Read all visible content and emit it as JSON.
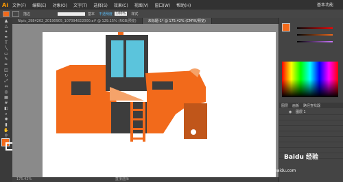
{
  "menu": {
    "logo": "Ai",
    "items": [
      "文件(F)",
      "编辑(E)",
      "对象(O)",
      "文字(T)",
      "选择(S)",
      "效果(C)",
      "视图(V)",
      "窗口(W)",
      "帮助(H)"
    ],
    "workspace": "基本功能"
  },
  "control": {
    "stroke_label": "描边",
    "style_label": "基本",
    "opacity_label": "不透明度",
    "opacity_value": "100%",
    "style_field": "样式"
  },
  "tabs": [
    {
      "label": "Nipic_2984202_20190905_107094822000.ai* @ 129.15% (RGB/预览)"
    },
    {
      "label": "未标题-1* @ 175.42% (CMYK/预览)"
    }
  ],
  "status": {
    "zoom": "175.42%",
    "tool": "直接选择"
  },
  "layers": {
    "tabs": [
      "图层",
      "画板",
      "路径查找器"
    ],
    "layer_name": "图层 1"
  },
  "colors": {
    "orange": "#f26a1b",
    "dark": "#3d3d3d",
    "window": "#5bc4dc",
    "peach": "#f5a36a",
    "brown": "#c0561a"
  },
  "watermark": {
    "text": "Baidu 经验",
    "url": "jingyan.baidu.com"
  }
}
